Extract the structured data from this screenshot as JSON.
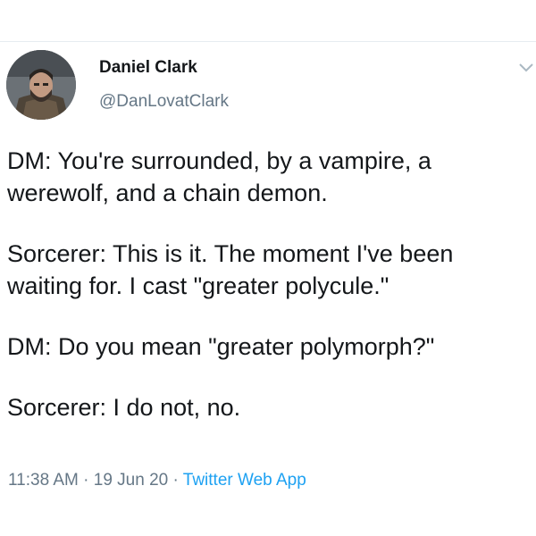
{
  "tweet": {
    "author": {
      "name": "Daniel Clark",
      "handle": "@DanLovatClark",
      "avatar_icon": "profile-photo"
    },
    "menu_icon": "chevron-down-icon",
    "body": [
      "DM: You're surrounded, by a vampire, a werewolf, and a chain demon.",
      "Sorcerer: This is it. The moment I've been waiting for. I cast \"greater polycule.\"",
      "DM: Do you mean \"greater polymorph?\"",
      "Sorcerer: I do not, no."
    ],
    "time": "11:38 AM",
    "date": "19 Jun 20",
    "separator": "·",
    "source": "Twitter Web App"
  },
  "colors": {
    "text": "#14171a",
    "secondary": "#657786",
    "link": "#1da1f2",
    "divider": "#e6ecf0"
  }
}
